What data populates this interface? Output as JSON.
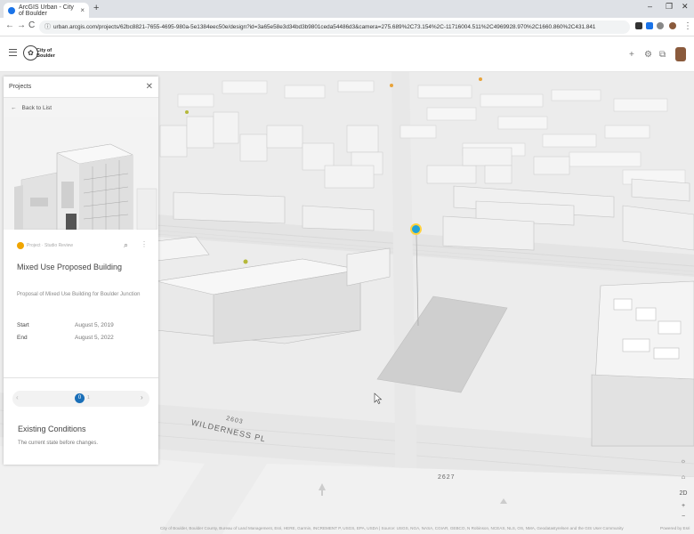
{
  "browser": {
    "tab_title": "ArcGIS Urban - City of Boulder",
    "tab_close": "×",
    "new_tab": "+",
    "win_min": "–",
    "win_max": "❐",
    "win_close": "✕",
    "back": "←",
    "forward": "→",
    "reload": "C",
    "url": "urban.arcgis.com/projects/62bc8821-7655-4695-980a-5e1384eec50e/design?id=3a65e58e3d34bd3b9801ceda54486d3&camera=275.689%2C73.154%2C-11716004.511%2C4969928.970%2C1660.860%2C431.841",
    "lock": "ⓘ",
    "star": "☆"
  },
  "app_header": {
    "logo_glyph": "✿",
    "logo_text": "City of Boulder",
    "add_icon": "+",
    "settings_icon": "⚙",
    "share_icon": "⧉"
  },
  "panel": {
    "header": "Projects",
    "close": "✕",
    "back_arrow": "←",
    "back_label": "Back to List",
    "project_type": "Project · Studio Review",
    "zoom_icon": "⌕",
    "more_icon": "⋮",
    "title": "Mixed Use Proposed Building",
    "description": "Proposal of Mixed Use Building for Boulder Junction",
    "start_label": "Start",
    "start_value": "August 5, 2019",
    "end_label": "End",
    "end_value": "August 5, 2022"
  },
  "timeline": {
    "prev": "‹",
    "next": "›",
    "knob_value": "0",
    "knob_label": "1",
    "title": "Existing Conditions",
    "description": "The current state before changes."
  },
  "map": {
    "street_1": "WILDERNESS PL",
    "street_2": "2603",
    "street_3": "2627",
    "compass": "☼",
    "ctl_home": "⌂",
    "ctl_2d": "2D",
    "ctl_zoom_in": "+",
    "ctl_zoom_out": "−",
    "attribution": "City of Boulder, Boulder County, Bureau of Land Management, Esri, HERE, Garmin, INCREMENT P, USGS, EPA, USDA | Source: USGS, NGA, NASA, CGIAR, GEBCO, N Robinson, NCEAS, NLS, OS, NMA, Geodatastyrelsen and the GIS User Community",
    "powered_by": "Powered by Esri"
  }
}
